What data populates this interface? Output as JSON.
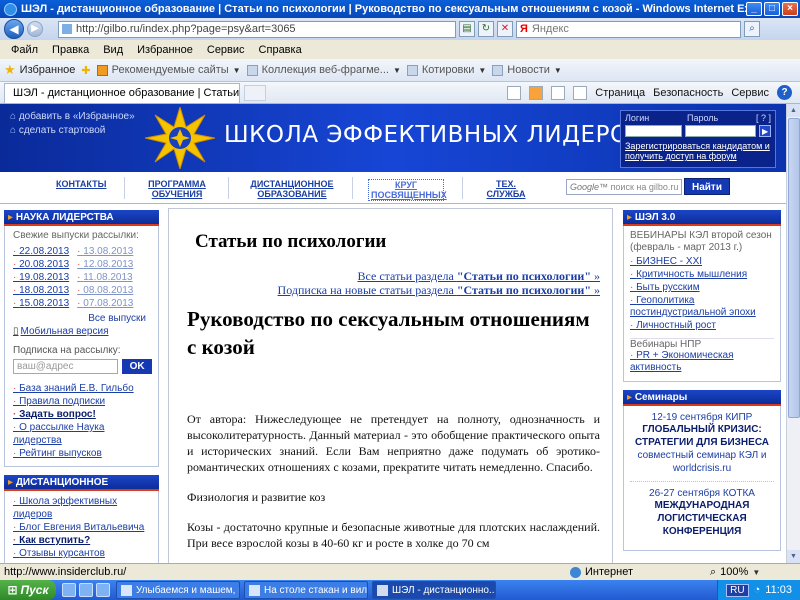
{
  "browser": {
    "window_title": "ШЭЛ - дистанционное образование | Статьи по психологии | Руководство по сексуальным отношениям с козой - Windows Internet Explorer пре",
    "address": "http://gilbo.ru/index.php?page=psy&art=3065",
    "search_placeholder": "Яндекс",
    "search_brand": "Я",
    "menu": [
      "Файл",
      "Правка",
      "Вид",
      "Избранное",
      "Сервис",
      "Справка"
    ],
    "favorites_label": "Избранное",
    "favorites": [
      "Рекомендуемые сайты",
      "Коллекция веб-фрагме...",
      "Котировки",
      "Новости"
    ],
    "tab_title": "ШЭЛ - дистанционное образование | Статьи по пс...",
    "commands": [
      "Страница",
      "Безопасность",
      "Сервис"
    ],
    "status_url": "http://www.insiderclub.ru/",
    "status_zone": "Интернет",
    "zoom": "100%"
  },
  "header": {
    "links": [
      "добавить в «Избранное»",
      "сделать стартовой"
    ],
    "site_title": "ШКОЛА ЭФФЕКТИВНЫХ ЛИДЕРОВ",
    "login_label": "Логин",
    "password_label": "Пароль",
    "help_label": "[ ? ]",
    "register_link": "Зарегистрироваться кандидатом и получить доступ на форум"
  },
  "nav": {
    "items": [
      "КОНТАКТЫ",
      "ПРОГРАММА ОБУЧЕНИЯ",
      "ДИСТАНЦИОННОЕ ОБРАЗОВАНИЕ",
      "КРУГ ПОСВЯЩЕННЫХ",
      "ТЕХ. СЛУЖБА"
    ],
    "search_brand": "Google™",
    "search_placeholder": "поиск на gilbo.ru",
    "find_button": "Найти"
  },
  "left": {
    "leadership_title": "НАУКА ЛИДЕРСТВА",
    "fresh_label": "Свежие выпуски рассылки:",
    "dates_new": [
      "22.08.2013",
      "20.08.2013",
      "19.08.2013",
      "18.08.2013",
      "15.08.2013"
    ],
    "dates_old": [
      "13.08.2013",
      "12.08.2013",
      "11.08.2013",
      "08.08.2013",
      "07.08.2013"
    ],
    "all_issues": "Все выпуски",
    "mobile": "Мобильная версия",
    "subscribe_label": "Подписка на рассылку:",
    "email_placeholder": "ваш@адрес",
    "ok_button": "OK",
    "links": [
      "База знаний Е.В. Гильбо",
      "Правила подписки",
      "Задать вопрос!",
      "О рассылке Наука лидерства",
      "Рейтинг выпусков"
    ],
    "distance_title": "ДИСТАНЦИОННОЕ ОБУЧЕНИЕ",
    "distance_links": [
      "Школа эффективных лидеров",
      "Блог Евгения Витальевича",
      "Как вступить?",
      "Отзывы курсантов"
    ]
  },
  "main": {
    "section_title": "Статьи по психологии",
    "all_articles_prefix": "Все статьи раздела ",
    "all_articles_name": "\"Статьи по психологии\"",
    "subscribe_prefix": "Подписка на новые статьи раздела ",
    "subscribe_name": "\"Статьи по психологии\"",
    "link_suffix": " »",
    "article_title": "Руководство по сексуальным отношениям с козой",
    "paragraphs": [
      "От автора: Нижеследующее не претендует на полноту, однозначность и высоколитературность. Данный материал - это обобщение практического опыта и исторических знаний. Если Вам неприятно даже подумать об эротико-романтических отношениях с козами, прекратите читать немедленно. Спасибо.",
      "Физиология и развитие коз",
      "Козы - достаточно крупные и безопасные животные для плотских наслаждений. При весе взрослой козы в 40-60 кг и росте в холке до 70 см"
    ]
  },
  "right": {
    "shel_title": "ШЭЛ 3.0",
    "webinars_label": "ВЕБИНАРЫ КЭЛ второй сезон (февраль - март 2013 г.)",
    "webinars": [
      "БИЗНЕС - XXI",
      "Критичность мышления",
      "Быть русским",
      "Геополитика постиндустриальной эпохи",
      "Личностный рост"
    ],
    "npr_label": "Вебинары НПР",
    "npr": [
      "PR + Экономическая активность"
    ],
    "seminars_title": "Семинары",
    "seminars": [
      {
        "date": "12-19 сентября КИПР",
        "name": "ГЛОБАЛЬНЫЙ КРИЗИС: СТРАТЕГИИ ДЛЯ БИЗНЕСА",
        "desc": "совместный семинар КЭЛ и worldcrisis.ru"
      },
      {
        "date": "26-27 сентября КОТКА",
        "name": "МЕЖДУНАРОДНАЯ ЛОГИСТИЧЕСКАЯ КОНФЕРЕНЦИЯ",
        "desc": ""
      }
    ]
  },
  "taskbar": {
    "start": "Пуск",
    "tasks": [
      "Улыбаемся и машем, па...",
      "На столе стакан и вилк...",
      "ШЭЛ - дистанционно..."
    ],
    "lang": "RU",
    "clock": "11:03"
  }
}
